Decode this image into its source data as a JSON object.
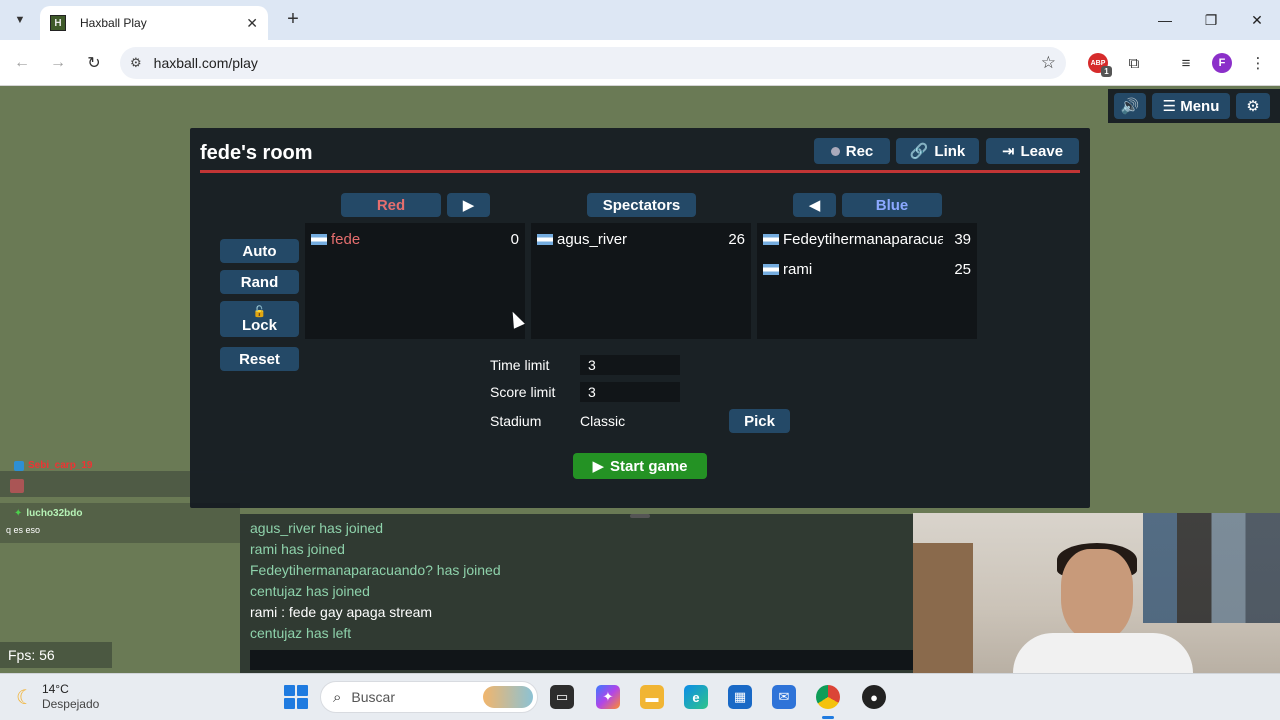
{
  "browser": {
    "tab_title": "Haxball Play",
    "tab_favicon": "H",
    "url": "haxball.com/play",
    "extension_badge": "ABP",
    "extension_count": "1",
    "profile_initial": "F"
  },
  "game_topbar": {
    "menu_label": "Menu"
  },
  "room": {
    "title": "fede's room",
    "rec_label": "Rec",
    "link_label": "Link",
    "leave_label": "Leave",
    "side_buttons": {
      "auto": "Auto",
      "rand": "Rand",
      "lock": "Lock",
      "reset": "Reset"
    },
    "red_header": "Red",
    "spectators_header": "Spectators",
    "blue_header": "Blue",
    "red_players": [
      {
        "name": "fede",
        "ping": "0"
      }
    ],
    "spectators": [
      {
        "name": "agus_river",
        "ping": "26"
      }
    ],
    "blue_players": [
      {
        "name": "Fedeytihermanaparacuando?",
        "ping": "39"
      },
      {
        "name": "rami",
        "ping": "25"
      }
    ],
    "settings": {
      "time_limit_label": "Time limit",
      "time_limit_value": "3",
      "score_limit_label": "Score limit",
      "score_limit_value": "3",
      "stadium_label": "Stadium",
      "stadium_value": "Classic",
      "pick_label": "Pick"
    },
    "start_label": "Start game"
  },
  "chat": {
    "lines": [
      {
        "text": "agus_river has joined",
        "kind": "join"
      },
      {
        "text": "rami has joined",
        "kind": "join"
      },
      {
        "text": "Fedeytihermanaparacuando? has joined",
        "kind": "join"
      },
      {
        "text": "centujaz has joined",
        "kind": "join"
      },
      {
        "text": "rami : fede gay apaga stream",
        "kind": "msg"
      },
      {
        "text": "centujaz has left",
        "kind": "join"
      }
    ]
  },
  "overlay": {
    "user1": "Sebi_carp_19",
    "user2": "lucho32bdo",
    "user2_msg": "q es eso",
    "fps": "Fps: 56"
  },
  "taskbar": {
    "temperature": "14°C",
    "weather": "Despejado",
    "search_placeholder": "Buscar"
  },
  "colors": {
    "red_team": "#e56e6e",
    "blue_team": "#8ba8ff",
    "button": "#244967",
    "start": "#249224",
    "chat_join": "#8ed2ab"
  }
}
